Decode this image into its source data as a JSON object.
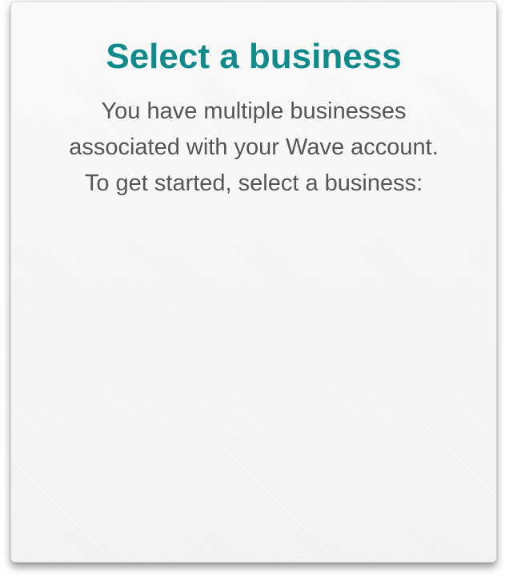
{
  "dialog": {
    "title": "Select a business",
    "description_lines": [
      "You have multiple businesses",
      "associated with your Wave account.",
      "To get started, select a business:"
    ]
  },
  "colors": {
    "title": "#118a8c",
    "body_text": "#555555",
    "card_background": "#f5f5f5"
  }
}
